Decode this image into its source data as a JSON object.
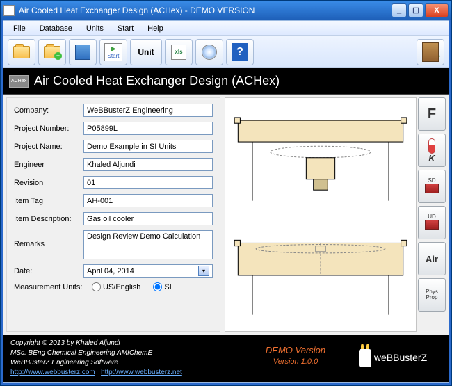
{
  "window": {
    "title": "Air Cooled Heat Exchanger Design  (ACHex) - DEMO VERSION"
  },
  "menu": {
    "file": "File",
    "database": "Database",
    "units": "Units",
    "start": "Start",
    "help": "Help"
  },
  "toolbar": {
    "unit_label": "Unit",
    "start_label": "Start",
    "excel_label": "xls",
    "achex_label": "ACHex"
  },
  "banner": {
    "title": "Air Cooled Heat Exchanger Design (ACHex)"
  },
  "form": {
    "labels": {
      "company": "Company:",
      "project_number": "Project Number:",
      "project_name": "Project Name:",
      "engineer": "Engineer",
      "revision": "Revision",
      "item_tag": "Item Tag",
      "item_description": "Item Description:",
      "remarks": "Remarks",
      "date": "Date:",
      "measurement_units": "Measurement Units:"
    },
    "values": {
      "company": "WeBBusterZ Engineering",
      "project_number": "P05899L",
      "project_name": "Demo Example in SI Units",
      "engineer": "Khaled Aljundi",
      "revision": "01",
      "item_tag": "AH-001",
      "item_description": "Gas oil cooler",
      "remarks": "Design Review Demo Calculation",
      "date": "April      04, 2014"
    },
    "units": {
      "us": "US/English",
      "si": "SI",
      "selected": "si"
    }
  },
  "sidebar": {
    "f": "F",
    "k": "K",
    "sd": "SD",
    "ud": "UD",
    "air": "Air",
    "phys": "Phys",
    "prop": "Prop"
  },
  "footer": {
    "copyright": "Copyright © 2013 by Khaled Aljundi",
    "line2": "MSc. BEng Chemical Engineering AMIChemE",
    "line3": "WeBBusterZ Engineering Software",
    "link1": "http://www.webbusterz.com",
    "link2": "http://www.webbusterz.net",
    "demo": "DEMO Version",
    "version": "Version 1.0.0",
    "brand": "weBBusterZ"
  }
}
